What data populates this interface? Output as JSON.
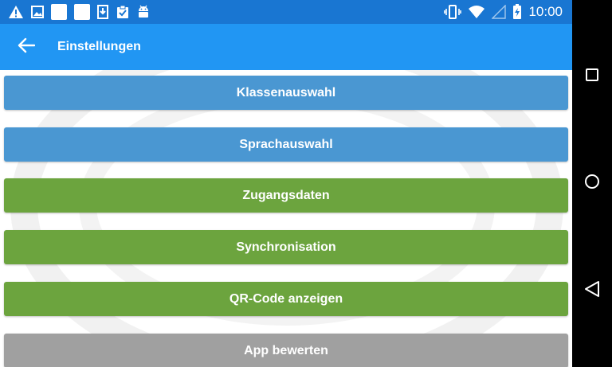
{
  "status_bar": {
    "time": "10:00",
    "left_icons": [
      "warning-icon",
      "image-icon",
      "blank-square-icon",
      "blank-square-icon",
      "download-icon",
      "clipboard-check-icon",
      "android-icon"
    ],
    "right_icons": [
      "vibrate-icon",
      "wifi-icon",
      "signal-icon",
      "battery-charging-icon"
    ]
  },
  "app_bar": {
    "title": "Einstellungen",
    "background": "#2196F3"
  },
  "menu": {
    "items": [
      {
        "label": "Klassenauswahl",
        "color": "#4A97D2"
      },
      {
        "label": "Sprachauswahl",
        "color": "#4A97D2"
      },
      {
        "label": "Zugangsdaten",
        "color": "#6CA43E"
      },
      {
        "label": "Synchronisation",
        "color": "#6CA43E"
      },
      {
        "label": "QR-Code anzeigen",
        "color": "#6CA43E"
      },
      {
        "label": "App bewerten",
        "color": "#A0A0A0"
      }
    ]
  },
  "nav_bar": {
    "buttons": [
      "recents-icon",
      "home-icon",
      "back-icon"
    ]
  }
}
